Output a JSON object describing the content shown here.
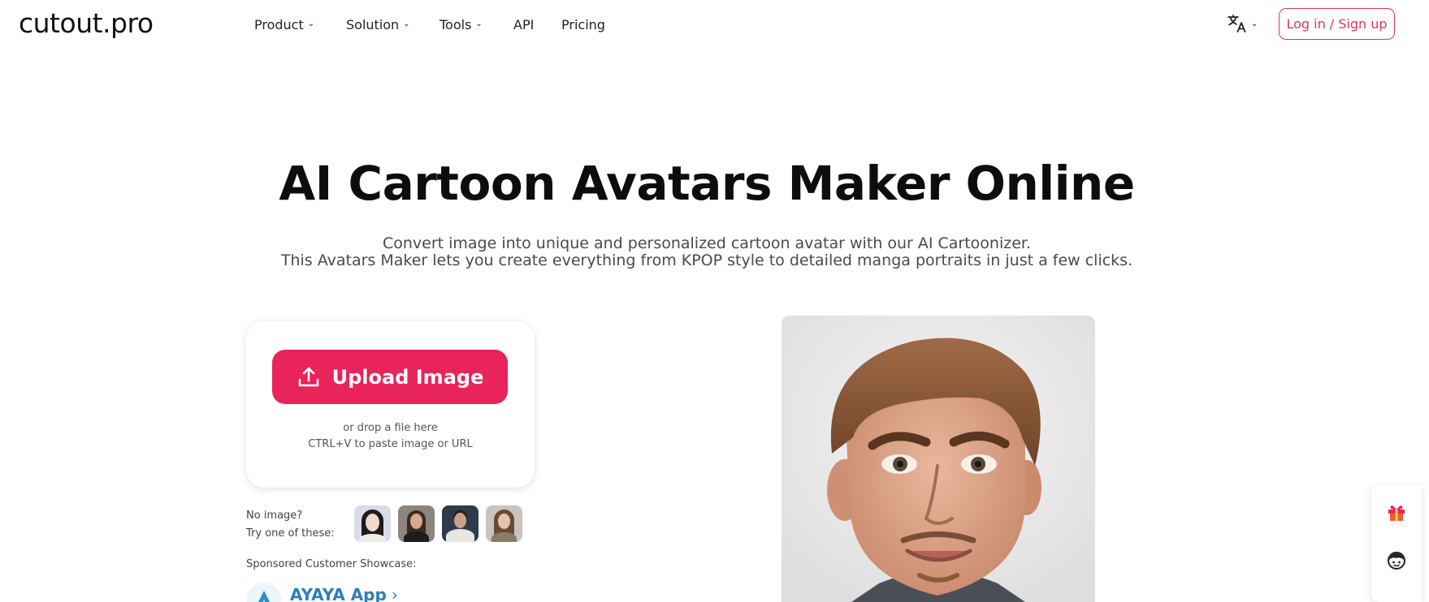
{
  "brand": {
    "logo": "cutout.pro"
  },
  "nav": {
    "items": [
      {
        "label": "Product",
        "has_dropdown": true
      },
      {
        "label": "Solution",
        "has_dropdown": true
      },
      {
        "label": "Tools",
        "has_dropdown": true
      },
      {
        "label": "API",
        "has_dropdown": false
      },
      {
        "label": "Pricing",
        "has_dropdown": false
      }
    ],
    "chevron": "⌄",
    "language_icon": "translate-icon",
    "login_label": "Log in / Sign up"
  },
  "hero": {
    "title": "AI Cartoon Avatars Maker Online",
    "subtitle_line1": "Convert image into unique and personalized cartoon avatar with our AI Cartoonizer.",
    "subtitle_line2": "This Avatars Maker lets you create everything from KPOP style to detailed manga portraits in just a few clicks."
  },
  "upload": {
    "button_label": "Upload Image",
    "drop_hint": "or drop a file here",
    "paste_hint": "CTRL+V to paste image or URL"
  },
  "samples": {
    "line1": "No image?",
    "line2": "Try one of these:"
  },
  "sponsored": {
    "label": "Sponsored Customer Showcase:",
    "app_name": "AYAYA App",
    "arrow": "›"
  },
  "colors": {
    "accent": "#e8245a",
    "login_border": "#e5325e",
    "sponsor_link": "#2c7fb8"
  }
}
